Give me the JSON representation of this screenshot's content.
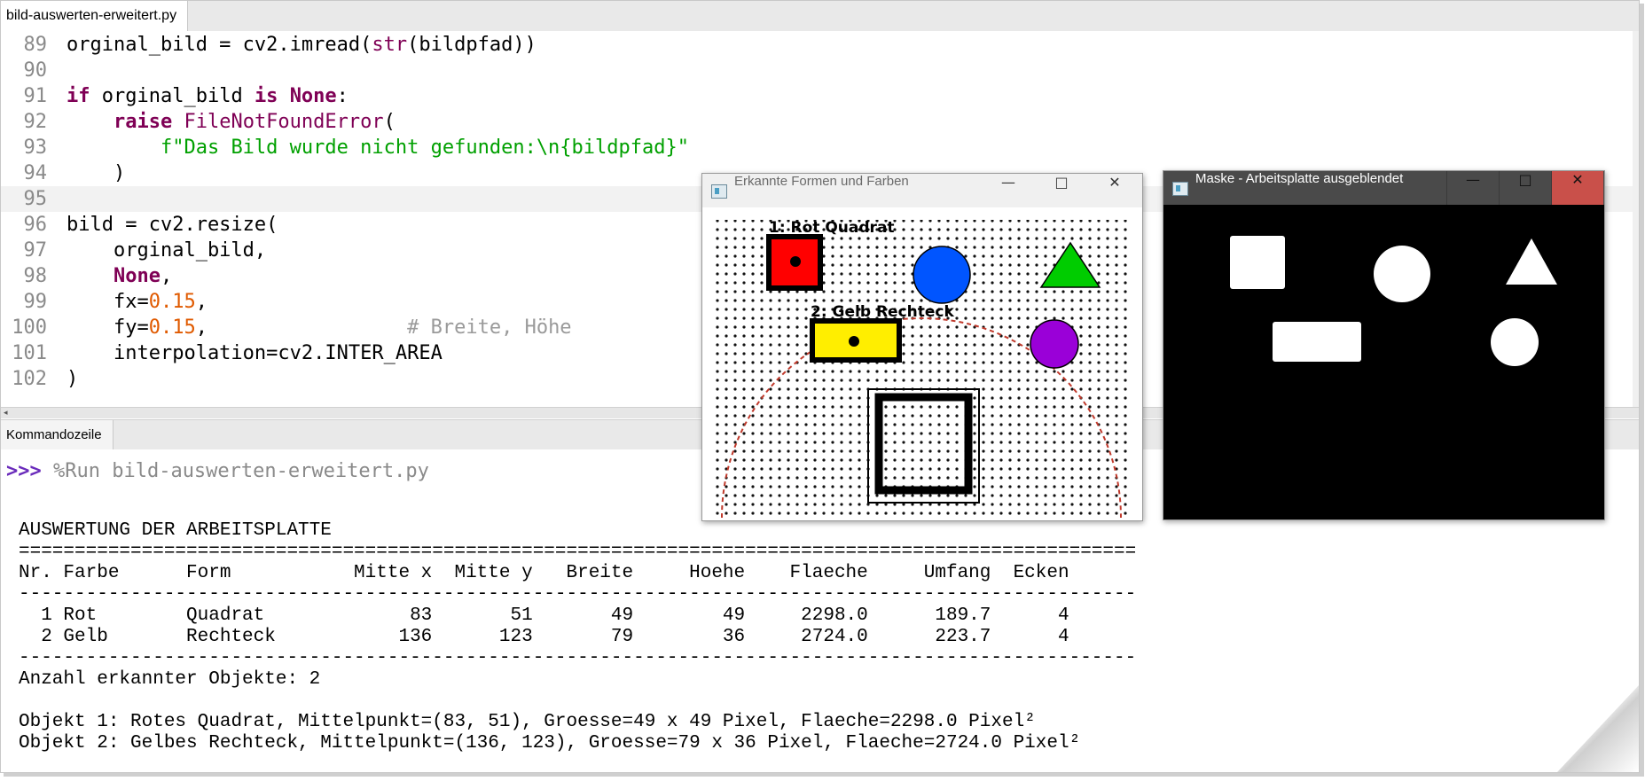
{
  "editor": {
    "tab_label": "bild-auswerten-erweitert.py",
    "lines": [
      {
        "n": "89",
        "parts": [
          [
            "orginal_bild = cv2.imread(",
            ""
          ],
          [
            "str",
            "bi"
          ],
          [
            "(bildpfad))",
            ""
          ]
        ]
      },
      {
        "n": "90",
        "parts": []
      },
      {
        "n": "91",
        "parts": [
          [
            "if",
            "kw"
          ],
          [
            " orginal_bild ",
            ""
          ],
          [
            "is",
            "kw"
          ],
          [
            " ",
            ""
          ],
          [
            "None",
            "kw"
          ],
          [
            ":",
            ""
          ]
        ]
      },
      {
        "n": "92",
        "parts": [
          [
            "    ",
            ""
          ],
          [
            "raise",
            "kw"
          ],
          [
            " ",
            ""
          ],
          [
            "FileNotFoundError",
            "cls"
          ],
          [
            "(",
            ""
          ]
        ]
      },
      {
        "n": "93",
        "parts": [
          [
            "        ",
            ""
          ],
          [
            "f\"Das Bild wurde nicht gefunden:\\n{bildpfad}\"",
            "str"
          ]
        ]
      },
      {
        "n": "94",
        "parts": [
          [
            "    )",
            ""
          ]
        ]
      },
      {
        "n": "95",
        "parts": [],
        "current": true
      },
      {
        "n": "96",
        "parts": [
          [
            "bild = cv2.resize(",
            ""
          ]
        ]
      },
      {
        "n": "97",
        "parts": [
          [
            "    orginal_bild,",
            ""
          ]
        ]
      },
      {
        "n": "98",
        "parts": [
          [
            "    ",
            ""
          ],
          [
            "None",
            "kw"
          ],
          [
            ",",
            ""
          ]
        ]
      },
      {
        "n": "99",
        "parts": [
          [
            "    fx=",
            ""
          ],
          [
            "0.15",
            "num"
          ],
          [
            ",",
            ""
          ]
        ]
      },
      {
        "n": "100",
        "parts": [
          [
            "    fy=",
            ""
          ],
          [
            "0.15",
            "num"
          ],
          [
            ",                 ",
            ""
          ],
          [
            "# Breite, Höhe",
            "cmt"
          ]
        ]
      },
      {
        "n": "101",
        "parts": [
          [
            "    interpolation=cv2.INTER_AREA",
            ""
          ]
        ]
      },
      {
        "n": "102",
        "parts": [
          [
            ")",
            ""
          ]
        ]
      }
    ]
  },
  "shell": {
    "tab_label": "Kommandozeile",
    "prompt": ">>>",
    "command": " %Run bild-auswerten-erweitert.py",
    "output": [
      "AUSWERTUNG DER ARBEITSPLATTE",
      "====================================================================================================",
      "Nr. Farbe      Form           Mitte x  Mitte y   Breite     Hoehe    Flaeche     Umfang  Ecken",
      "----------------------------------------------------------------------------------------------------",
      "  1 Rot        Quadrat             83       51       49        49     2298.0      189.7      4",
      "  2 Gelb       Rechteck           136      123       79        36     2724.0      223.7      4",
      "----------------------------------------------------------------------------------------------------",
      "Anzahl erkannter Objekte: 2",
      "",
      "Objekt 1: Rotes Quadrat, Mittelpunkt=(83, 51), Groesse=49 x 49 Pixel, Flaeche=2298.0 Pixel²",
      "Objekt 2: Gelbes Rechteck, Mittelpunkt=(136, 123), Groesse=79 x 36 Pixel, Flaeche=2724.0 Pixel²"
    ]
  },
  "window_shapes": {
    "title": "Erkannte Formen und Farben",
    "label_1": "1: Rot Quadrat",
    "label_2": "2: Gelb Rechteck",
    "colors": {
      "red": "#ff0000",
      "blue": "#0055ff",
      "green": "#00cc00",
      "yellow": "#ffee00",
      "purple": "#9a00d8",
      "dash": "#c0392b"
    }
  },
  "window_mask": {
    "title": "Maske - Arbeitsplatte ausgeblendet"
  },
  "window_buttons": {
    "minimize": "—",
    "maximize": "□",
    "close": "✕"
  }
}
